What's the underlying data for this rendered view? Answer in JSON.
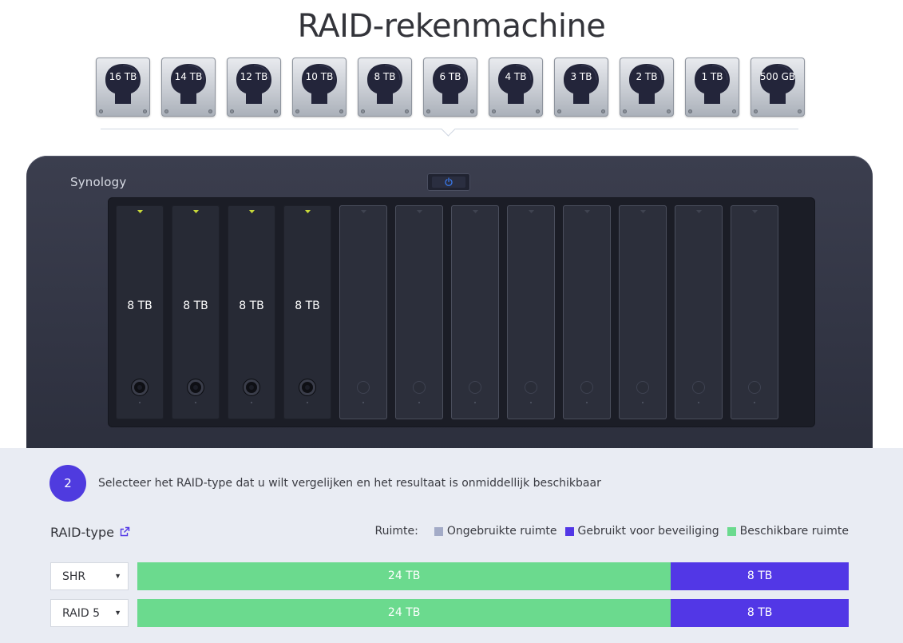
{
  "page": {
    "title": "RAID-rekenmachine"
  },
  "drive_picker": {
    "drives": [
      {
        "label": "16 TB"
      },
      {
        "label": "14 TB"
      },
      {
        "label": "12 TB"
      },
      {
        "label": "10 TB"
      },
      {
        "label": "8 TB"
      },
      {
        "label": "6 TB"
      },
      {
        "label": "4 TB"
      },
      {
        "label": "3 TB"
      },
      {
        "label": "2 TB"
      },
      {
        "label": "1 TB"
      },
      {
        "label": "500 GB"
      }
    ]
  },
  "nas": {
    "brand": "Synology",
    "bays": [
      {
        "capacity": "8 TB",
        "filled": true
      },
      {
        "capacity": "8 TB",
        "filled": true
      },
      {
        "capacity": "8 TB",
        "filled": true
      },
      {
        "capacity": "8 TB",
        "filled": true
      },
      {
        "capacity": "",
        "filled": false
      },
      {
        "capacity": "",
        "filled": false
      },
      {
        "capacity": "",
        "filled": false
      },
      {
        "capacity": "",
        "filled": false
      },
      {
        "capacity": "",
        "filled": false
      },
      {
        "capacity": "",
        "filled": false
      },
      {
        "capacity": "",
        "filled": false
      },
      {
        "capacity": "",
        "filled": false
      }
    ]
  },
  "step": {
    "number": "2",
    "text": "Selecteer het RAID-type dat u wilt vergelijken en het resultaat is onmiddellijk beschikbaar"
  },
  "raid_section": {
    "label": "RAID-type",
    "legend": {
      "title": "Ruimte:",
      "items": [
        {
          "label": "Ongebruikte ruimte",
          "color": "#a3abc7"
        },
        {
          "label": "Gebruikt voor beveiliging",
          "color": "#5237e6"
        },
        {
          "label": "Beschikbare ruimte",
          "color": "#6bda8e"
        }
      ]
    }
  },
  "raid_rows": [
    {
      "type": "SHR",
      "segments": [
        {
          "label": "24 TB",
          "kind": "available",
          "value_tb": 24
        },
        {
          "label": "8 TB",
          "kind": "protection",
          "value_tb": 8
        }
      ]
    },
    {
      "type": "RAID 5",
      "segments": [
        {
          "label": "24 TB",
          "kind": "available",
          "value_tb": 24
        },
        {
          "label": "8 TB",
          "kind": "protection",
          "value_tb": 8
        }
      ]
    }
  ],
  "colors": {
    "available": "#6bda8e",
    "protection": "#5237e6",
    "unused": "#a3abc7",
    "accent": "#4f3bdf"
  }
}
